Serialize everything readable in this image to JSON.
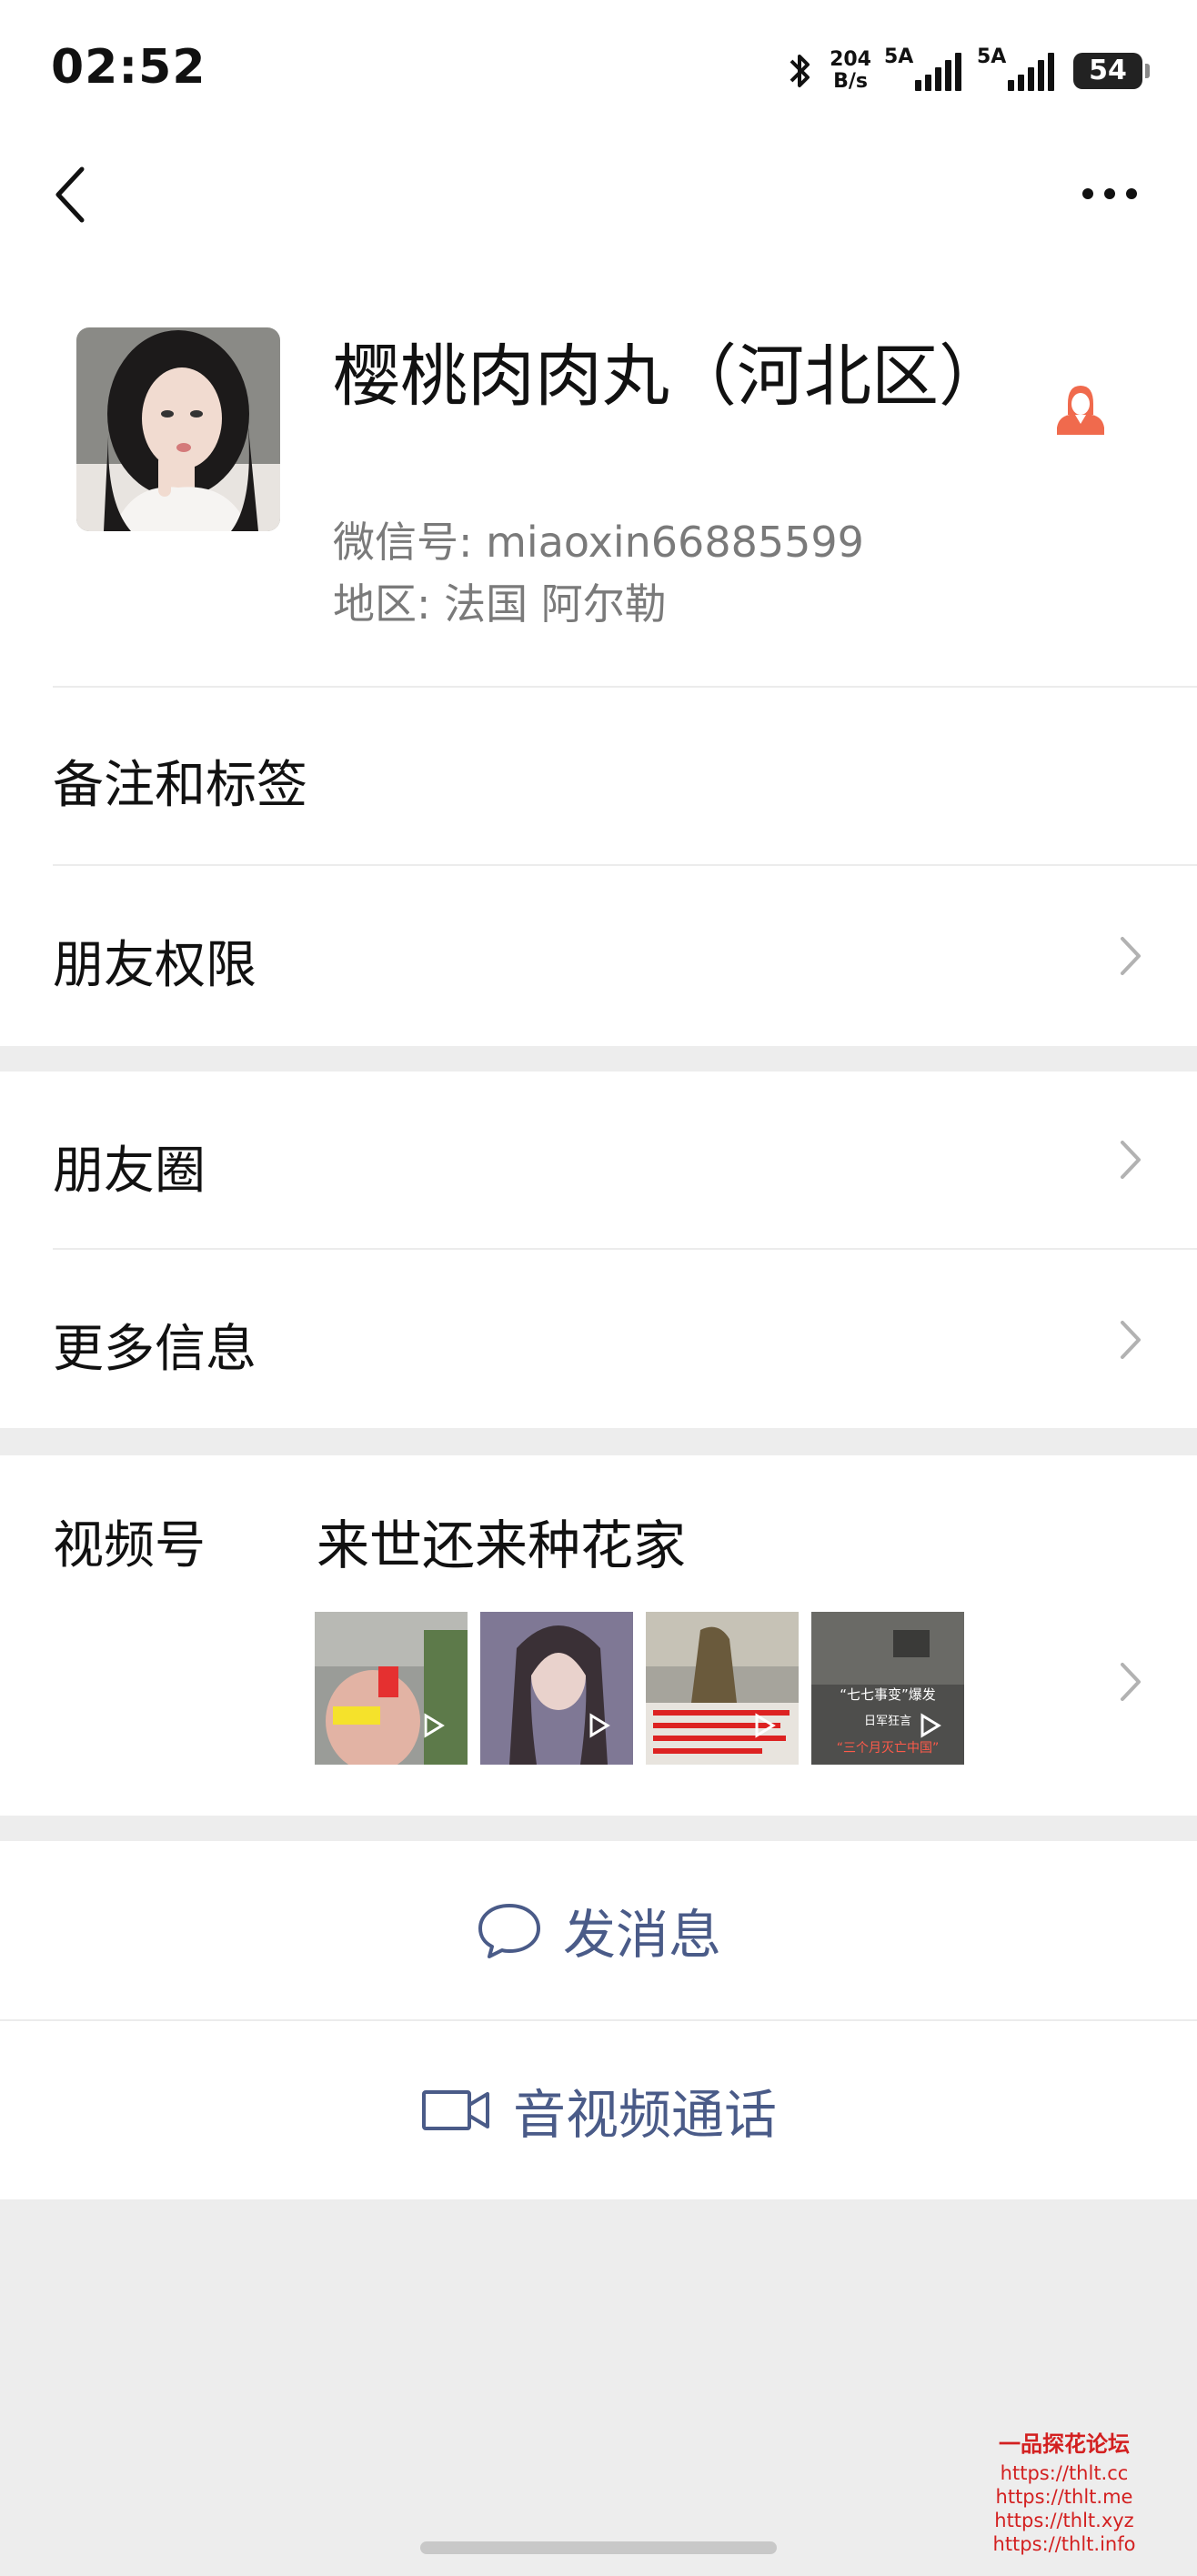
{
  "status_bar": {
    "time": "02:52",
    "net_speed_value": "204",
    "net_speed_unit": "B/s",
    "sim1_label": "5A",
    "sim2_label": "5A",
    "battery": "54"
  },
  "profile": {
    "name": "樱桃肉肉丸（河北区）",
    "wechat_id": "微信号: miaoxin66885599",
    "region": "地区: 法国 阿尔勒"
  },
  "menu": {
    "remarks_tags": "备注和标签",
    "friend_permissions": "朋友权限",
    "moments": "朋友圈",
    "more_info": "更多信息"
  },
  "channels": {
    "label": "视频号",
    "name": "来世还来种花家",
    "thumbnails": [
      {
        "caption": ""
      },
      {
        "caption": ""
      },
      {
        "caption": ""
      },
      {
        "caption": "“七七事变”爆发 日军狂言 “三个月灭亡中国”"
      }
    ]
  },
  "actions": {
    "send_message": "发消息",
    "video_call": "音视频通话"
  },
  "watermark": {
    "brand": "一品探花论坛",
    "urls": [
      "https://thlt.cc",
      "https://thlt.me",
      "https://thlt.xyz",
      "https://thlt.info"
    ]
  },
  "colors": {
    "accent_link": "#4a5b88",
    "gender_icon": "#f06a4d",
    "background": "#ededed"
  }
}
